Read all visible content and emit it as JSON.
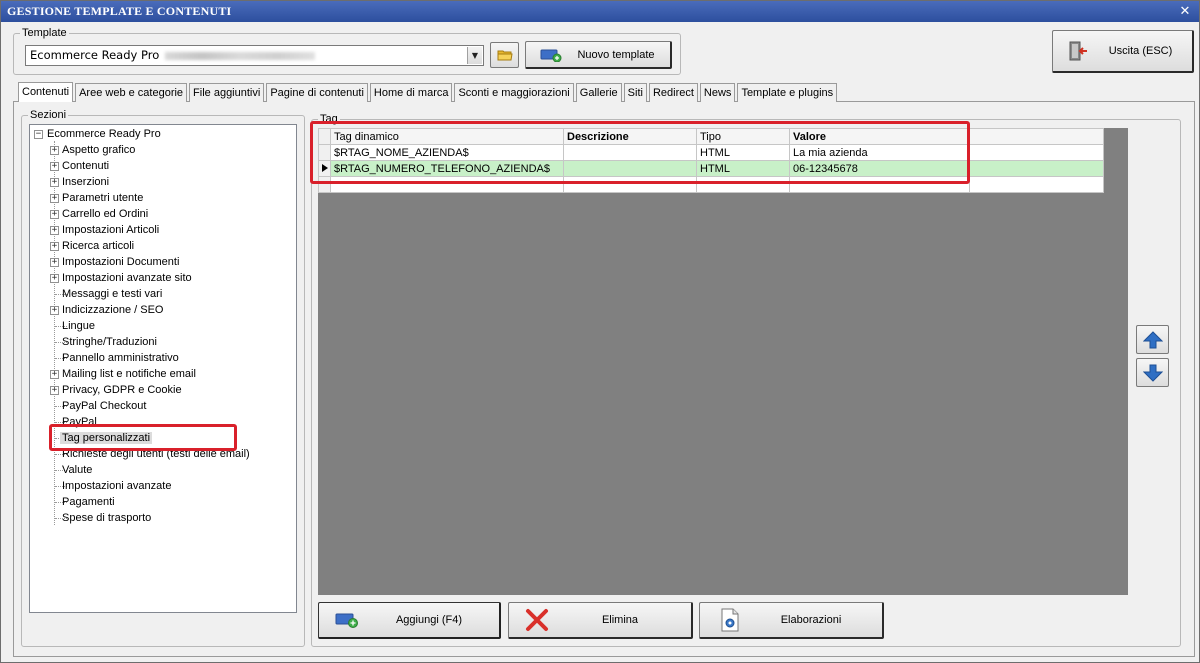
{
  "window": {
    "title": "GESTIONE TEMPLATE E CONTENUTI",
    "close_glyph": "✕"
  },
  "template_group": {
    "legend": "Template",
    "selected_value": "Ecommerce Ready Pro",
    "new_template_label": "Nuovo template"
  },
  "exit_button": {
    "label": "Uscita (ESC)"
  },
  "tabs": [
    "Contenuti",
    "Aree web e categorie",
    "File aggiuntivi",
    "Pagine di contenuti",
    "Home di marca",
    "Sconti e maggiorazioni",
    "Gallerie",
    "Siti",
    "Redirect",
    "News",
    "Template e plugins"
  ],
  "sections": {
    "legend": "Sezioni",
    "root": "Ecommerce Ready Pro",
    "items": [
      "Aspetto grafico",
      "Contenuti",
      "Inserzioni",
      "Parametri utente",
      "Carrello ed Ordini",
      "Impostazioni Articoli",
      "Ricerca articoli",
      "Impostazioni Documenti",
      "Impostazioni avanzate sito",
      "Messaggi e testi vari",
      "Indicizzazione / SEO",
      "Lingue",
      "Stringhe/Traduzioni",
      "Pannello amministrativo",
      "Mailing list e notifiche email",
      "Privacy, GDPR e Cookie",
      "PayPal Checkout",
      "PayPal",
      "Tag personalizzati",
      "Richieste degli utenti (testi delle email)",
      "Valute",
      "Impostazioni avanzate",
      "Pagamenti",
      "Spese di trasporto"
    ]
  },
  "tag_group": {
    "legend": "Tag",
    "columns": [
      "Tag dinamico",
      "Descrizione",
      "Tipo",
      "Valore"
    ],
    "rows": [
      {
        "tag": "$RTAG_NOME_AZIENDA$",
        "descrizione": "",
        "tipo": "HTML",
        "valore": "La mia azienda"
      },
      {
        "tag": "$RTAG_NUMERO_TELEFONO_AZIENDA$",
        "descrizione": "",
        "tipo": "HTML",
        "valore": "06-12345678"
      }
    ]
  },
  "actions": {
    "add_label": "Aggiungi (F4)",
    "delete_label": "Elimina",
    "process_label": "Elaborazioni"
  },
  "colors": {
    "title_bar": "#2d4f9e",
    "highlight_box": "#d9202a",
    "current_row": "#c8f0c8"
  }
}
